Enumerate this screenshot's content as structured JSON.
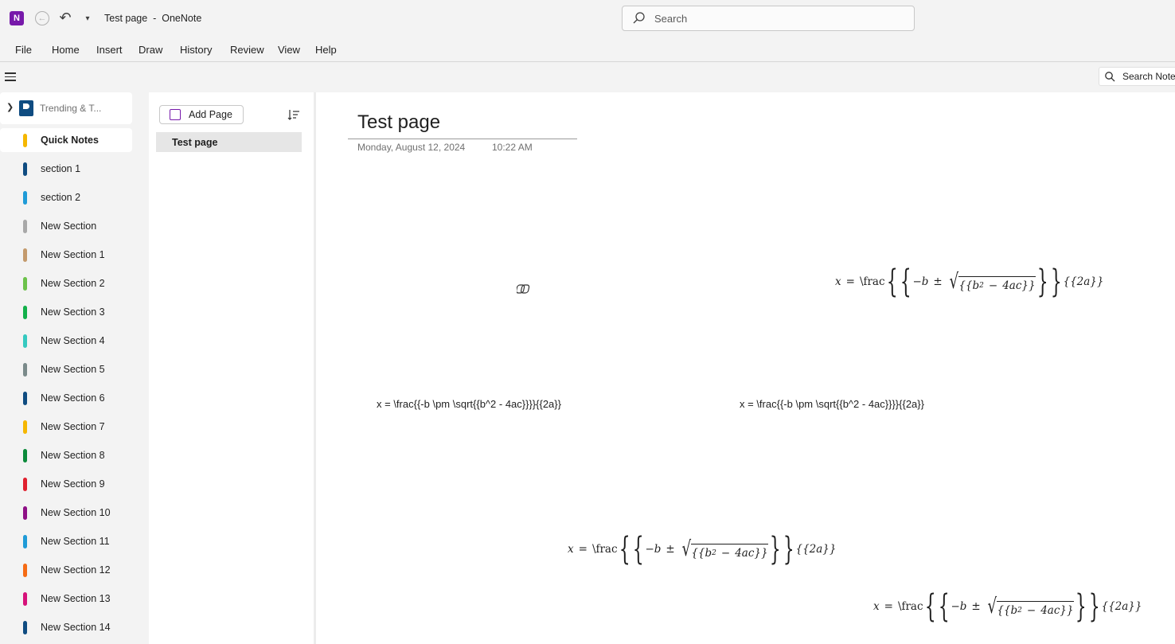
{
  "titlebar": {
    "app_icon_letter": "N",
    "title": "Test page  -  OneNote",
    "search_placeholder": "Search"
  },
  "menu": [
    "File",
    "Home",
    "Insert",
    "Draw",
    "History",
    "Review",
    "View",
    "Help"
  ],
  "subbar": {
    "search_notebooks": "Search Notebooks"
  },
  "notebook": {
    "name": "Trending & T..."
  },
  "sections": [
    {
      "label": "Quick Notes",
      "color": "#f5b700",
      "active": true
    },
    {
      "label": "section 1",
      "color": "#0f4c81"
    },
    {
      "label": "section 2",
      "color": "#1f9bd7"
    },
    {
      "label": "New Section",
      "color": "#a8a8a8"
    },
    {
      "label": "New Section 1",
      "color": "#c49a6c"
    },
    {
      "label": "New Section 2",
      "color": "#6cc24a"
    },
    {
      "label": "New Section 3",
      "color": "#12b04a"
    },
    {
      "label": "New Section 4",
      "color": "#35c9c0"
    },
    {
      "label": "New Section 5",
      "color": "#7a8a8a"
    },
    {
      "label": "New Section 6",
      "color": "#0f4c81"
    },
    {
      "label": "New Section 7",
      "color": "#f5b700"
    },
    {
      "label": "New Section 8",
      "color": "#0b8a3a"
    },
    {
      "label": "New Section 9",
      "color": "#e0202e"
    },
    {
      "label": "New Section 10",
      "color": "#8e1086"
    },
    {
      "label": "New Section 11",
      "color": "#1f9bd7"
    },
    {
      "label": "New Section 12",
      "color": "#f56b14"
    },
    {
      "label": "New Section 13",
      "color": "#d6127a"
    },
    {
      "label": "New Section 14",
      "color": "#0f4c81"
    }
  ],
  "pages_pane": {
    "add_page_label": "Add Page",
    "pages": [
      "Test page"
    ]
  },
  "page": {
    "title": "Test page",
    "date": "Monday, August 12, 2024",
    "time": "10:22 AM",
    "plain_equation": "x = \\frac{{-b \\pm \\sqrt{{b^2 - 4ac}}}}{{2a}}",
    "math_equation": {
      "lhs": "x",
      "eq": "=",
      "frac_cmd": "\\frac",
      "neg_b": "−b",
      "pm": "±",
      "radicand_open": "{{b",
      "exponent": "2",
      "minus": "−",
      "radicand_rest": "4ac}}",
      "tail": "{{2a}}"
    }
  },
  "colors": {
    "accent": "#7719aa",
    "chrome_bg": "#f3f3f3"
  }
}
